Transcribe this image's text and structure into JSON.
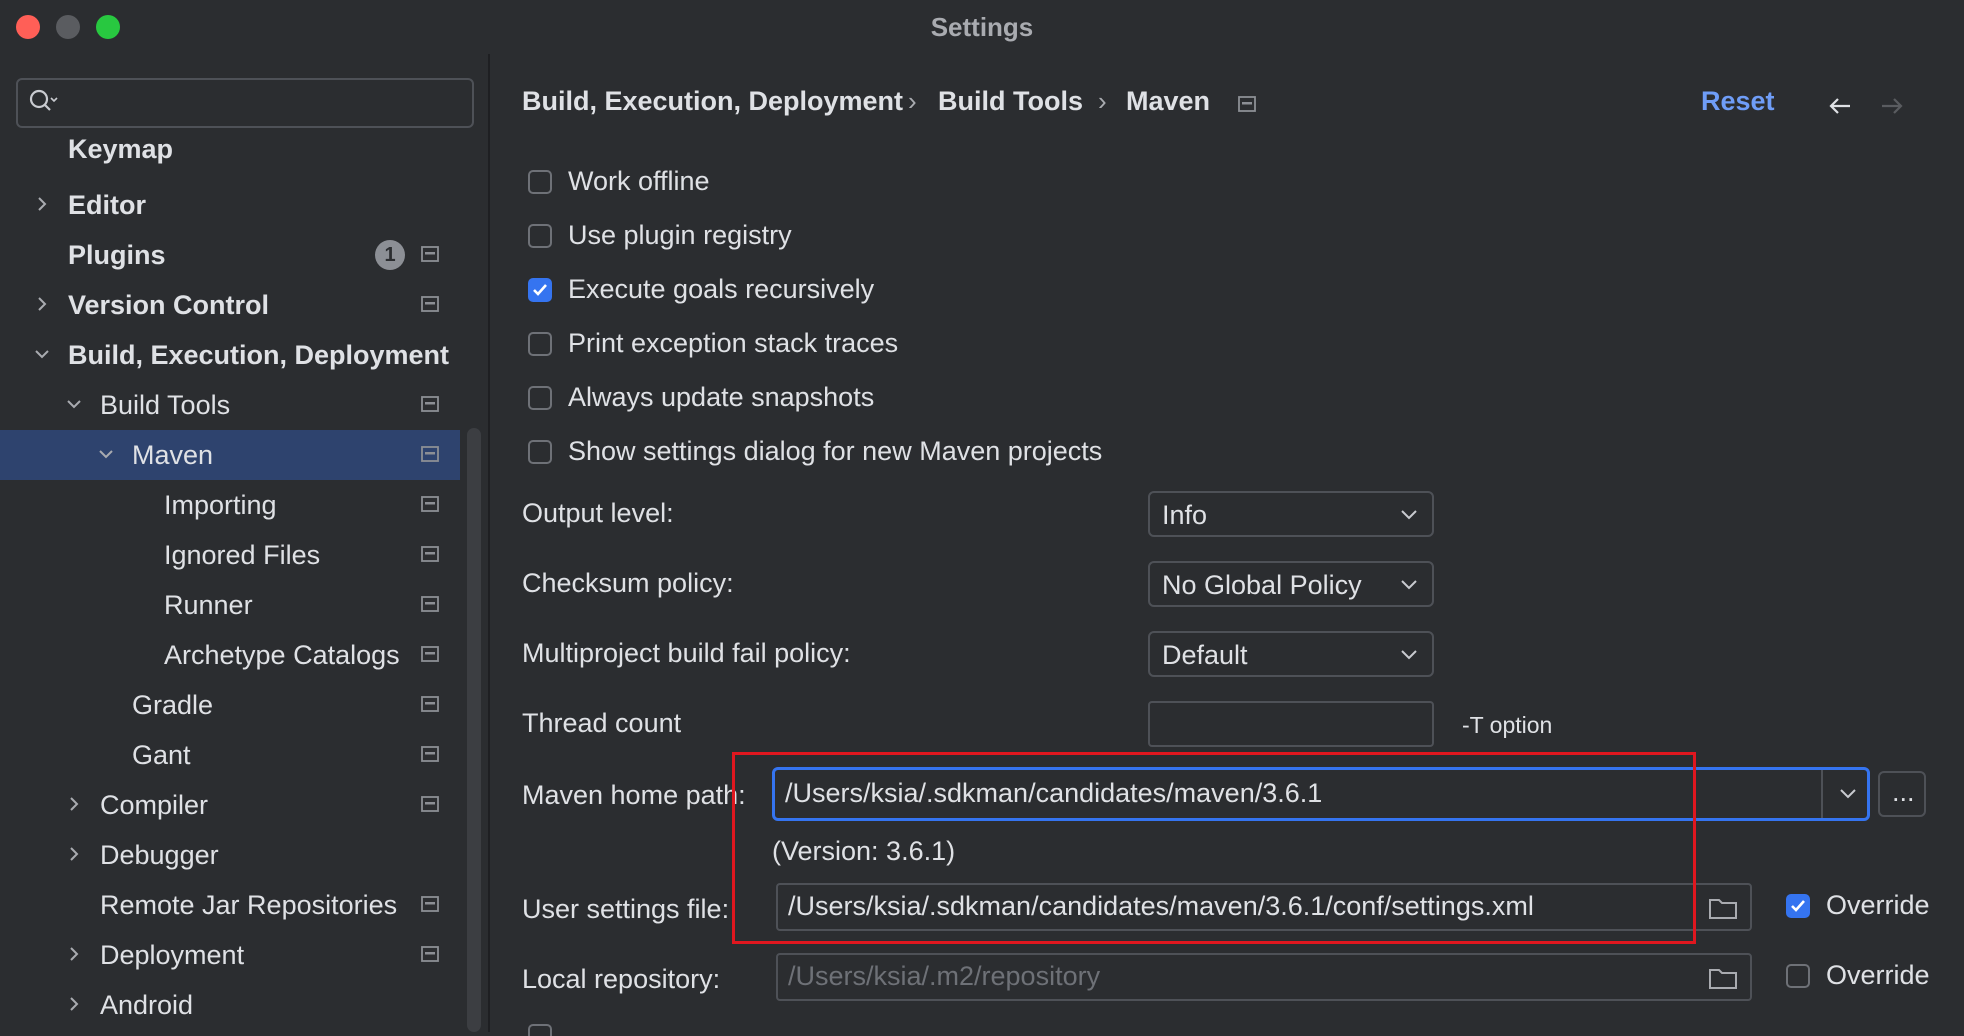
{
  "window": {
    "title": "Settings"
  },
  "search": {
    "placeholder": ""
  },
  "sidebar": {
    "items": [
      {
        "label": "Keymap"
      },
      {
        "label": "Editor"
      },
      {
        "label": "Plugins",
        "badge": "1"
      },
      {
        "label": "Version Control"
      },
      {
        "label": "Build, Execution, Deployment"
      },
      {
        "label": "Build Tools"
      },
      {
        "label": "Maven",
        "selected": true
      },
      {
        "label": "Importing"
      },
      {
        "label": "Ignored Files"
      },
      {
        "label": "Runner"
      },
      {
        "label": "Archetype Catalogs"
      },
      {
        "label": "Gradle"
      },
      {
        "label": "Gant"
      },
      {
        "label": "Compiler"
      },
      {
        "label": "Debugger"
      },
      {
        "label": "Remote Jar Repositories"
      },
      {
        "label": "Deployment"
      },
      {
        "label": "Android"
      }
    ]
  },
  "breadcrumb": {
    "items": [
      "Build, Execution, Deployment",
      "Build Tools",
      "Maven"
    ],
    "separator": "›"
  },
  "header": {
    "reset_label": "Reset"
  },
  "options": [
    {
      "label": "Work offline",
      "checked": false
    },
    {
      "label": "Use plugin registry",
      "checked": false
    },
    {
      "label": "Execute goals recursively",
      "checked": true
    },
    {
      "label": "Print exception stack traces",
      "checked": false
    },
    {
      "label": "Always update snapshots",
      "checked": false
    },
    {
      "label": "Show settings dialog for new Maven projects",
      "checked": false
    }
  ],
  "form": {
    "output_level": {
      "label": "Output level:",
      "value": "Info"
    },
    "checksum_policy": {
      "label": "Checksum policy:",
      "value": "No Global Policy"
    },
    "fail_policy": {
      "label": "Multiproject build fail policy:",
      "value": "Default"
    },
    "thread_count": {
      "label": "Thread count",
      "value": "",
      "hint": "-T option"
    },
    "maven_home": {
      "label": "Maven home path:",
      "value": "/Users/ksia/.sdkman/candidates/maven/3.6.1",
      "version": "(Version: 3.6.1)",
      "browse_label": "..."
    },
    "user_settings": {
      "label": "User settings file:",
      "value": "/Users/ksia/.sdkman/candidates/maven/3.6.1/conf/settings.xml",
      "override_label": "Override",
      "override_checked": true
    },
    "local_repo": {
      "label": "Local repository:",
      "placeholder": "/Users/ksia/.m2/repository",
      "override_label": "Override",
      "override_checked": false
    }
  },
  "colors": {
    "accent": "#3574f0",
    "link": "#6f9df7",
    "highlight_box": "#e0171f",
    "selection": "#2e436e"
  }
}
